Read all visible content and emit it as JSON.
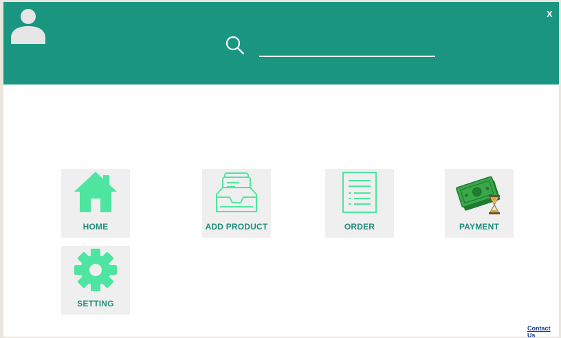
{
  "header": {
    "close_label": "X",
    "search": {
      "value": "",
      "placeholder": ""
    }
  },
  "menu": {
    "home": "HOME",
    "add_product": "ADD PRODUCT",
    "order": "ORDER",
    "payment": "PAYMENT",
    "setting": "SETTING"
  },
  "footer": {
    "contact_label": "Contact Us"
  },
  "colors": {
    "header_bg": "#1a9680",
    "tile_bg": "#efefef",
    "icon_green": "#4ee5a0",
    "label_green": "#1f8c7a"
  },
  "icons": {
    "avatar": "user-avatar-icon",
    "search": "search-icon",
    "home": "house-icon",
    "add_product": "inbox-tray-icon",
    "order": "document-list-icon",
    "payment": "money-hourglass-icon",
    "setting": "gear-icon"
  }
}
